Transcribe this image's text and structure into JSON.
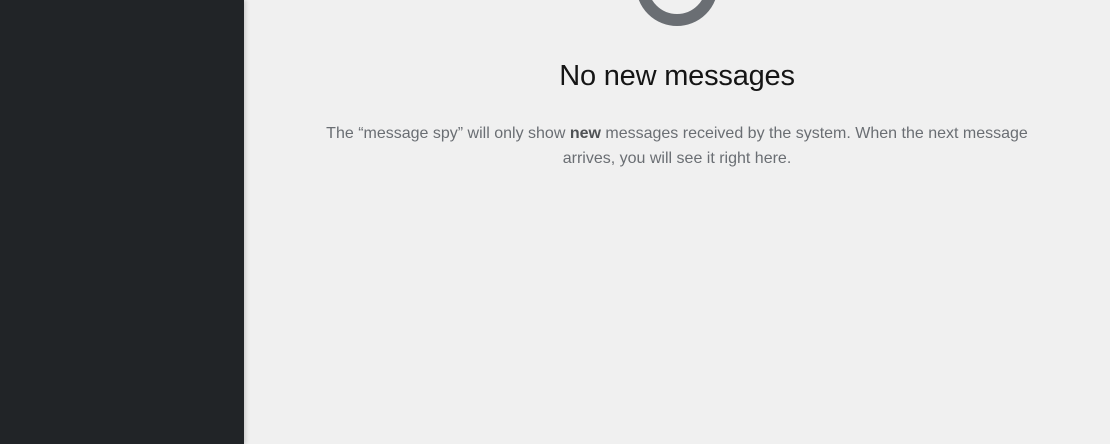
{
  "sidebar": {
    "background": "#212427"
  },
  "empty_state": {
    "icon": "message-inbox-icon",
    "title": "No new messages",
    "body_part1": "The “message spy” will only show ",
    "body_bold": "new",
    "body_part2": " messages received by the system. When the next message arrives, you will see it right here."
  }
}
